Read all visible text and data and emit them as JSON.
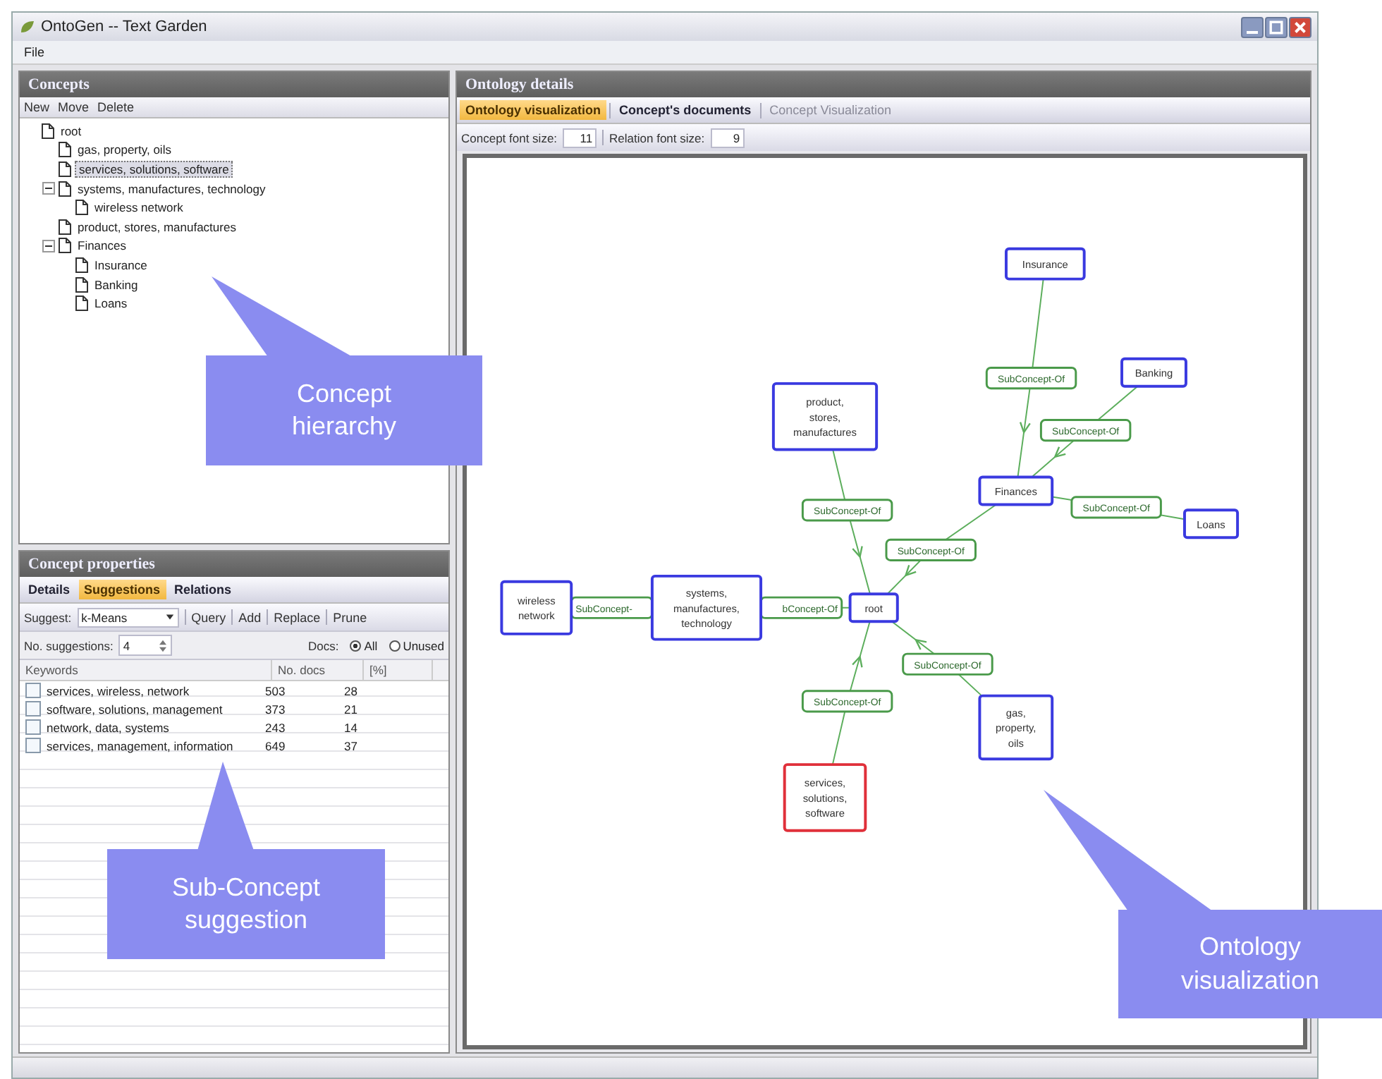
{
  "window": {
    "title": "OntoGen -- Text Garden"
  },
  "menu": [
    "File"
  ],
  "concepts": {
    "title": "Concepts",
    "toolbar": [
      "New",
      "Move",
      "Delete"
    ],
    "tree": [
      {
        "label": "root",
        "selected": false,
        "children": [
          {
            "label": "gas, property, oils",
            "selected": false
          },
          {
            "label": "services, solutions, software",
            "selected": true
          },
          {
            "label": "systems, manufactures, technology",
            "selected": false,
            "expanded": true,
            "children": [
              {
                "label": "wireless network",
                "selected": false
              }
            ]
          },
          {
            "label": "product, stores, manufactures",
            "selected": false
          },
          {
            "label": "Finances",
            "selected": false,
            "expanded": true,
            "children": [
              {
                "label": "Insurance",
                "selected": false
              },
              {
                "label": "Banking",
                "selected": false
              },
              {
                "label": "Loans",
                "selected": false
              }
            ]
          }
        ]
      }
    ]
  },
  "properties": {
    "title": "Concept properties",
    "tabs": [
      {
        "label": "Details",
        "selected": false
      },
      {
        "label": "Suggestions",
        "selected": true
      },
      {
        "label": "Relations",
        "selected": false
      }
    ],
    "suggest_label": "Suggest:",
    "method": "k-Means",
    "actions": [
      "Query",
      "Add",
      "Replace",
      "Prune"
    ],
    "count_label": "No. suggestions:",
    "count": "4",
    "docs_label": "Docs:",
    "docs_options": [
      {
        "label": "All",
        "selected": true
      },
      {
        "label": "Unused",
        "selected": false
      }
    ],
    "columns": [
      "Keywords",
      "No. docs",
      "[%]"
    ],
    "rows": [
      {
        "checked": false,
        "cells": [
          "services, wireless, network",
          "503",
          "28"
        ]
      },
      {
        "checked": false,
        "cells": [
          "software, solutions, management",
          "373",
          "21"
        ]
      },
      {
        "checked": false,
        "cells": [
          "network, data, systems",
          "243",
          "14"
        ]
      },
      {
        "checked": false,
        "cells": [
          "services, management, information",
          "649",
          "37"
        ]
      }
    ]
  },
  "details": {
    "title": "Ontology details",
    "tabs": [
      {
        "label": "Ontology visualization",
        "selected": true,
        "disabled": false
      },
      {
        "label": "Concept's documents",
        "selected": false,
        "disabled": false
      },
      {
        "label": "Concept Visualization",
        "selected": false,
        "disabled": true
      }
    ],
    "concept_font_label": "Concept font size:",
    "concept_font": "11",
    "relation_font_label": "Relation font size:",
    "relation_font": "9",
    "graph": {
      "nodes": [
        {
          "label": "Insurance",
          "selected": false
        },
        {
          "label": "Banking",
          "selected": false
        },
        {
          "label": "product, stores, manufactures",
          "selected": false
        },
        {
          "label": "Finances",
          "selected": false
        },
        {
          "label": "Loans",
          "selected": false
        },
        {
          "label": "wireless network",
          "selected": false
        },
        {
          "label": "systems, manufactures, technology",
          "selected": false
        },
        {
          "label": "root",
          "selected": false
        },
        {
          "label": "gas, property, oils",
          "selected": false
        },
        {
          "label": "services, solutions, software",
          "selected": true
        }
      ],
      "relations": [
        {
          "label": "SubConcept-Of"
        },
        {
          "label": "SubConcept-Of"
        },
        {
          "label": "SubConcept-Of"
        },
        {
          "label": "SubConcept-Of"
        },
        {
          "label": "SubConcept-Of"
        },
        {
          "label": "SubConcept-"
        },
        {
          "label": "bConcept-Of"
        },
        {
          "label": "SubConcept-Of"
        },
        {
          "label": "SubConcept-Of"
        }
      ]
    }
  },
  "callouts": [
    "Concept hierarchy",
    "Sub-Concept suggestion",
    "Ontology visualization"
  ]
}
